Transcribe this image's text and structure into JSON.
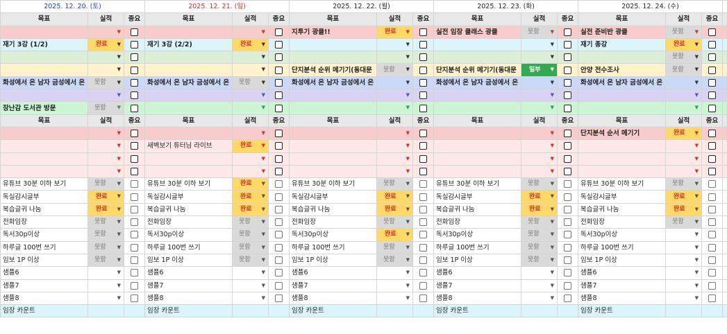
{
  "colors": {
    "header_bg": "#e8e8e8",
    "pink": "#f9cccc",
    "lightpink": "#fde8e8",
    "cyan": "#dcf4fb",
    "green": "#dcefd6",
    "yellow": "#fff2cc",
    "blue": "#c9daf8",
    "lavender": "#d9d2f0",
    "mint": "#ccf5d4",
    "status_done": "#ffd966",
    "status_notyet": "#dadada",
    "status_partial": "#34a853"
  },
  "dates": [
    {
      "label": "2025. 12. 20. (토)",
      "color": "#1a3fd6"
    },
    {
      "label": "2025. 12. 21. (일)",
      "color": "#d93025"
    },
    {
      "label": "2025. 12. 22. (월)",
      "color": "#222222"
    },
    {
      "label": "2025. 12. 23. (화)",
      "color": "#222222"
    },
    {
      "label": "2025. 12. 24. (수)",
      "color": "#222222"
    }
  ],
  "headers": {
    "goal": "목표",
    "status": "실적",
    "important": "중요"
  },
  "status_labels": {
    "done": "완료",
    "notyet": "못함",
    "partial": "일부"
  },
  "upper": {
    "row_colors": [
      "#f9cccc",
      "#dcf4fb",
      "#dcefd6",
      "#fff2cc",
      "#c9daf8",
      "#d9d2f0",
      "#ccf5d4"
    ],
    "arrow_colors": [
      "#d93025",
      "#333333",
      "#333333",
      "#333333",
      "#333333",
      "#4a55c8",
      "#2e9b4a"
    ],
    "rows": [
      [
        [
          "",
          ""
        ],
        [
          "",
          ""
        ],
        [
          "지투기 광클!!",
          "done"
        ],
        [
          "실전 임장 클래스 광클",
          "notyet"
        ],
        [
          "실전 준비반 광클",
          "notyet"
        ]
      ],
      [
        [
          "재기 3강 (1/2)",
          "done"
        ],
        [
          "재기 3강 (2/2)",
          "done"
        ],
        [
          "",
          ""
        ],
        [
          "",
          ""
        ],
        [
          "재기 종강",
          "done"
        ]
      ],
      [
        [
          "",
          ""
        ],
        [
          "",
          ""
        ],
        [
          "",
          ""
        ],
        [
          "",
          ""
        ],
        [
          "",
          "notyet"
        ]
      ],
      [
        [
          "",
          ""
        ],
        [
          "",
          ""
        ],
        [
          "단지분석 순위 메기기(동대문",
          "notyet"
        ],
        [
          "단지분석 순위 메기기(동대문",
          "partial"
        ],
        [
          "안양 전수조사",
          "notyet"
        ]
      ],
      [
        [
          "화성에서 온 남자 금성에서 온",
          "notyet"
        ],
        [
          "화성에서 온 남자 금성에서 온",
          "notyet"
        ],
        [
          "화성에서 온 남자 금성에서 온",
          ""
        ],
        [
          "화성에서 온 남자 금성에서 온",
          ""
        ],
        [
          "화성에서 온 남자 금성에서 온",
          ""
        ]
      ],
      [
        [
          "",
          ""
        ],
        [
          "",
          ""
        ],
        [
          "",
          ""
        ],
        [
          "",
          ""
        ],
        [
          "",
          ""
        ]
      ],
      [
        [
          "장난감 도서관 방문",
          "notyet"
        ],
        [
          "",
          ""
        ],
        [
          "",
          ""
        ],
        [
          "",
          ""
        ],
        [
          "",
          ""
        ]
      ]
    ]
  },
  "lower": {
    "row_colors": [
      "#f9cccc",
      "#fde8e8",
      "#fde8e8",
      "#fde8e8",
      "#ffffff",
      "#ffffff",
      "#ffffff",
      "#ffffff",
      "#ffffff",
      "#ffffff",
      "#ffffff",
      "#ffffff",
      "#ffffff",
      "#ffffff"
    ],
    "rows": [
      [
        [
          "",
          ""
        ],
        [
          "",
          ""
        ],
        [
          "",
          ""
        ],
        [
          "",
          ""
        ],
        [
          "단지분석 순서 메기기",
          "done"
        ]
      ],
      [
        [
          "",
          ""
        ],
        [
          "새벽보기 튜터님 라이브",
          "done"
        ],
        [
          "",
          ""
        ],
        [
          "",
          ""
        ],
        [
          "",
          ""
        ]
      ],
      [
        [
          "",
          ""
        ],
        [
          "",
          ""
        ],
        [
          "",
          ""
        ],
        [
          "",
          ""
        ],
        [
          "",
          ""
        ]
      ],
      [
        [
          "",
          ""
        ],
        [
          "",
          ""
        ],
        [
          "",
          ""
        ],
        [
          "",
          ""
        ],
        [
          "",
          ""
        ]
      ],
      [
        [
          "유튜브 30분 이하 보기",
          "notyet"
        ],
        [
          "유튜브 30분 이하 보기",
          "done"
        ],
        [
          "유튜브 30분 이하 보기",
          "notyet"
        ],
        [
          "유튜브 30분 이하 보기",
          "notyet"
        ],
        [
          "유튜브 30분 이하 보기",
          "notyet"
        ]
      ],
      [
        [
          "독실감시글부",
          "done"
        ],
        [
          "독실감시글부",
          "done"
        ],
        [
          "독실감시글부",
          "done"
        ],
        [
          "독실감시글부",
          "done"
        ],
        [
          "독실감시글부",
          "done"
        ]
      ],
      [
        [
          "복습글귀 나눔",
          "done"
        ],
        [
          "복습글귀 나눔",
          "done"
        ],
        [
          "복습글귀 나눔",
          "done"
        ],
        [
          "복습글귀 나눔",
          "done"
        ],
        [
          "복습글귀 나눔",
          "done"
        ]
      ],
      [
        [
          "전화임장",
          "notyet"
        ],
        [
          "전화임장",
          "notyet"
        ],
        [
          "전화임장",
          "notyet"
        ],
        [
          "전화임장",
          "notyet"
        ],
        [
          "전화임장",
          "notyet"
        ]
      ],
      [
        [
          "독서30p이상",
          "notyet"
        ],
        [
          "독서30p이상",
          "notyet"
        ],
        [
          "독서30p이상",
          "done"
        ],
        [
          "독서30p이상",
          "notyet"
        ],
        [
          "독서30p이상",
          ""
        ]
      ],
      [
        [
          "하루글 100번 쓰기",
          "notyet"
        ],
        [
          "하루글 100번 쓰기",
          "notyet"
        ],
        [
          "하루글 100번 쓰기",
          "notyet"
        ],
        [
          "하루글 100번 쓰기",
          "notyet"
        ],
        [
          "하루글 100번 쓰기",
          ""
        ]
      ],
      [
        [
          "임보 1P 이상",
          "notyet"
        ],
        [
          "임보 1P 이상",
          "notyet"
        ],
        [
          "임보 1P 이상",
          "notyet"
        ],
        [
          "임보 1P 이상",
          "notyet"
        ],
        [
          "임보 1P 이상",
          ""
        ]
      ],
      [
        [
          "샘플6",
          ""
        ],
        [
          "샘플6",
          ""
        ],
        [
          "샘플6",
          ""
        ],
        [
          "샘플6",
          ""
        ],
        [
          "샘플6",
          ""
        ]
      ],
      [
        [
          "샘플7",
          ""
        ],
        [
          "샘플7",
          ""
        ],
        [
          "샘플7",
          ""
        ],
        [
          "샘플7",
          ""
        ],
        [
          "샘플7",
          ""
        ]
      ],
      [
        [
          "샘플8",
          ""
        ],
        [
          "샘플8",
          ""
        ],
        [
          "샘플8",
          ""
        ],
        [
          "샘플8",
          ""
        ],
        [
          "샘플8",
          ""
        ]
      ]
    ]
  },
  "footer": {
    "label": "임장 카운트",
    "bg": "#dcf4fb"
  }
}
